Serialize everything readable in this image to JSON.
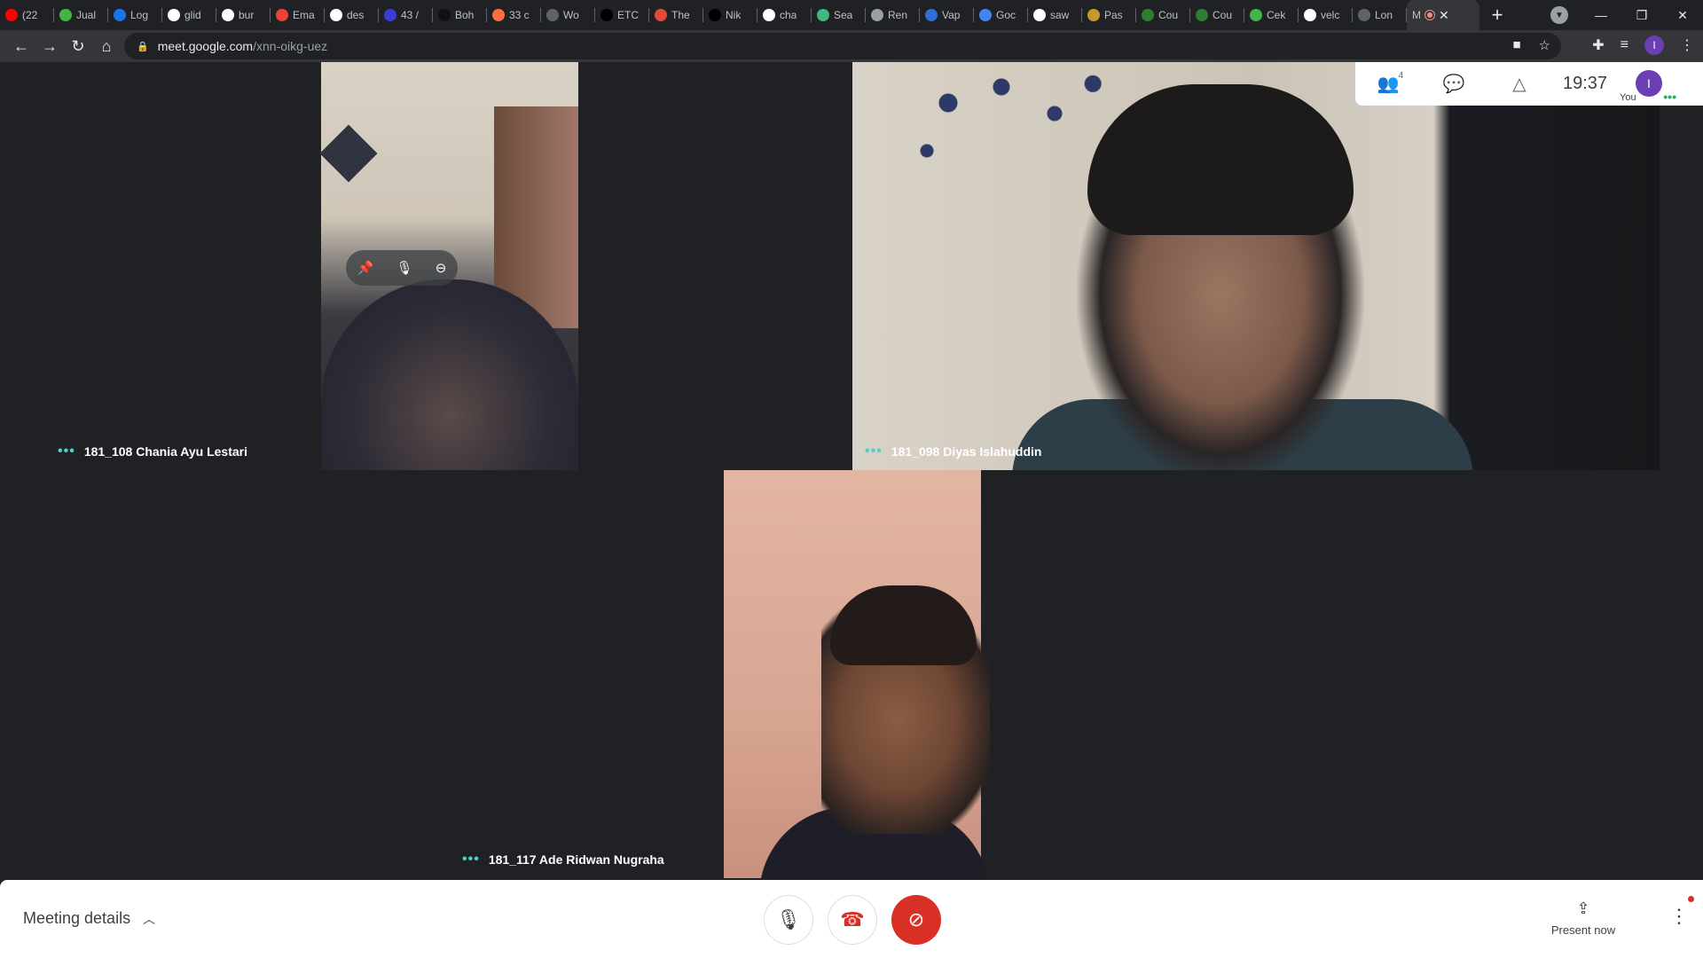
{
  "browser": {
    "tabs": [
      {
        "title": "(22",
        "fav": "youtube-icon",
        "color": "#ff0000"
      },
      {
        "title": "Jual",
        "fav": "tokopedia-icon",
        "color": "#42b549"
      },
      {
        "title": "Log",
        "fav": "app-icon",
        "color": "#1a73e8"
      },
      {
        "title": "glid",
        "fav": "google-icon",
        "color": "#ffffff"
      },
      {
        "title": "bur",
        "fav": "github-icon",
        "color": "#ffffff"
      },
      {
        "title": "Ema",
        "fav": "gmail-icon",
        "color": "#ea4335"
      },
      {
        "title": "des",
        "fav": "google-icon",
        "color": "#ffffff"
      },
      {
        "title": "43 /",
        "fav": "app-icon",
        "color": "#3b3bd9"
      },
      {
        "title": "Boh",
        "fav": "app-icon",
        "color": "#111111"
      },
      {
        "title": "33 c",
        "fav": "app-icon",
        "color": "#ff6d3b"
      },
      {
        "title": "Wo",
        "fav": "globe-icon",
        "color": "#5f6368"
      },
      {
        "title": "ETC",
        "fav": "app-icon",
        "color": "#000000"
      },
      {
        "title": "The",
        "fav": "app-icon",
        "color": "#e24b37"
      },
      {
        "title": "Nik",
        "fav": "nike-icon",
        "color": "#000000"
      },
      {
        "title": "cha",
        "fav": "github-icon",
        "color": "#ffffff"
      },
      {
        "title": "Sea",
        "fav": "vue-icon",
        "color": "#41b883"
      },
      {
        "title": "Ren",
        "fav": "app-icon",
        "color": "#9aa0a6"
      },
      {
        "title": "Vap",
        "fav": "app-icon",
        "color": "#2f6fd6"
      },
      {
        "title": "Goc",
        "fav": "translate-icon",
        "color": "#4285f4"
      },
      {
        "title": "saw",
        "fav": "google-icon",
        "color": "#ffffff"
      },
      {
        "title": "Pas",
        "fav": "app-icon",
        "color": "#c49a2c"
      },
      {
        "title": "Cou",
        "fav": "app-icon",
        "color": "#2e7d32"
      },
      {
        "title": "Cou",
        "fav": "app-icon",
        "color": "#2e7d32"
      },
      {
        "title": "Cek",
        "fav": "tokopedia-icon",
        "color": "#42b549"
      },
      {
        "title": "velc",
        "fav": "google-icon",
        "color": "#ffffff"
      },
      {
        "title": "Lon",
        "fav": "loading-icon",
        "color": "#5f6368"
      }
    ],
    "active_tab": {
      "title": "M",
      "close": "✕"
    },
    "new_tab": "+",
    "window_controls": {
      "minimize": "—",
      "restore": "❐",
      "close": "✕"
    },
    "url_host": "meet.google.com",
    "url_path": "/xnn-oikg-uez",
    "profile_initial": "I"
  },
  "meet": {
    "participants": [
      {
        "name": "181_108 Chania Ayu Lestari"
      },
      {
        "name": "181_098 Diyas Islahuddin"
      },
      {
        "name": "181_117 Ade Ridwan Nugraha"
      }
    ],
    "hover_controls": {
      "pin": "pin-icon",
      "mute": "mic-icon",
      "remove": "remove-icon"
    },
    "top_panel": {
      "people_count": "4",
      "clock": "19:37",
      "you_label": "You",
      "avatar_initial": "I"
    },
    "bottom": {
      "meeting_details": "Meeting details",
      "present_now": "Present now"
    },
    "colors": {
      "hangup_red": "#d93025",
      "camera_off_red": "#d93025",
      "speaking_dots": "#4dd0c8"
    }
  }
}
